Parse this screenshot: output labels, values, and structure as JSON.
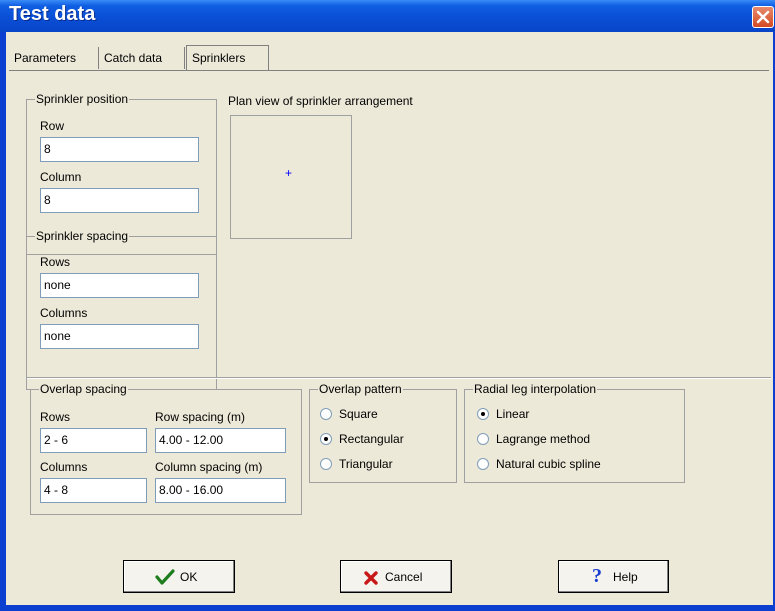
{
  "window": {
    "title": "Test data"
  },
  "tabs": [
    "Parameters",
    "Catch data",
    "Sprinklers"
  ],
  "sprinkler_position": {
    "label": "Sprinkler position",
    "row_label": "Row",
    "row_value": "8",
    "column_label": "Column",
    "column_value": "8"
  },
  "plan_view": {
    "label": "Plan view of sprinkler arrangement",
    "marker": "+"
  },
  "sprinkler_spacing": {
    "label": "Sprinkler spacing",
    "rows_label": "Rows",
    "rows_value": "none",
    "columns_label": "Columns",
    "columns_value": "none"
  },
  "overlap_spacing": {
    "label": "Overlap spacing",
    "rows_label": "Rows",
    "rows_value": "2 - 6",
    "row_spacing_label": "Row spacing (m)",
    "row_spacing_value": "4.00 - 12.00",
    "columns_label": "Columns",
    "columns_value": "4 - 8",
    "column_spacing_label": "Column spacing (m)",
    "column_spacing_value": "8.00 - 16.00"
  },
  "overlap_pattern": {
    "label": "Overlap pattern",
    "options": [
      "Square",
      "Rectangular",
      "Triangular"
    ],
    "selected": "Rectangular"
  },
  "radial_leg": {
    "label": "Radial leg interpolation",
    "options": [
      "Linear",
      "Lagrange method",
      "Natural cubic spline"
    ],
    "selected": "Linear"
  },
  "buttons": {
    "ok": "OK",
    "cancel": "Cancel",
    "help": "Help"
  },
  "colors": {
    "titlebar": "#0a4fd6",
    "close": "#d34a23",
    "face": "#ece9d8",
    "marker": "#0000ff"
  }
}
